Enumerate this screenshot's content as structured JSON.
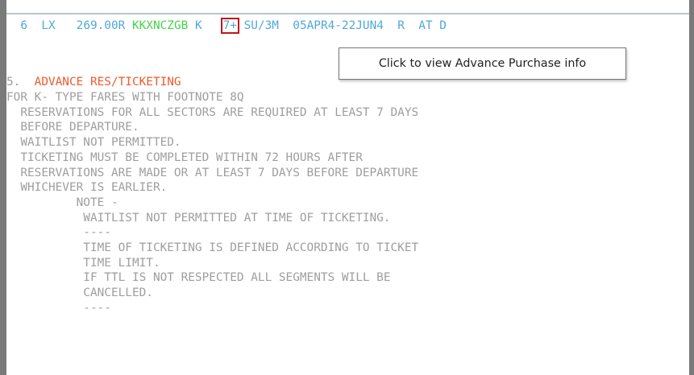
{
  "fare_row": {
    "line_no": "6",
    "carrier": "LX",
    "amount": "269.00R",
    "fare_basis": "KKXNCZGB",
    "booking_class": "K",
    "advance_purchase": "7+",
    "min_max_stay": "SU/3M",
    "travel_dates": "05APR4-22JUN4",
    "fare_type": "R",
    "flags": "AT D"
  },
  "tooltip": {
    "text": "Click to view Advance Purchase info"
  },
  "rule": {
    "section_no": "5.",
    "section_title": "ADVANCE RES/TICKETING",
    "lines": [
      "FOR K- TYPE FARES WITH FOOTNOTE 8Q",
      "  RESERVATIONS FOR ALL SECTORS ARE REQUIRED AT LEAST 7 DAYS",
      "  BEFORE DEPARTURE.",
      "  WAITLIST NOT PERMITTED.",
      "  TICKETING MUST BE COMPLETED WITHIN 72 HOURS AFTER",
      "  RESERVATIONS ARE MADE OR AT LEAST 7 DAYS BEFORE DEPARTURE",
      "  WHICHEVER IS EARLIER.",
      "          NOTE -",
      "           WAITLIST NOT PERMITTED AT TIME OF TICKETING.",
      "           ----",
      "           TIME OF TICKETING IS DEFINED ACCORDING TO TICKET",
      "           TIME LIMIT.",
      "           IF TTL IS NOT RESPECTED ALL SEGMENTS WILL BE",
      "           CANCELLED.",
      "           ----"
    ]
  },
  "colors": {
    "blue_text": "#4fa8d8",
    "green_text": "#44d34a",
    "orange_text": "#ef5a2b",
    "grey_text": "#9e9e9e",
    "highlight_box": "#c0161c"
  }
}
